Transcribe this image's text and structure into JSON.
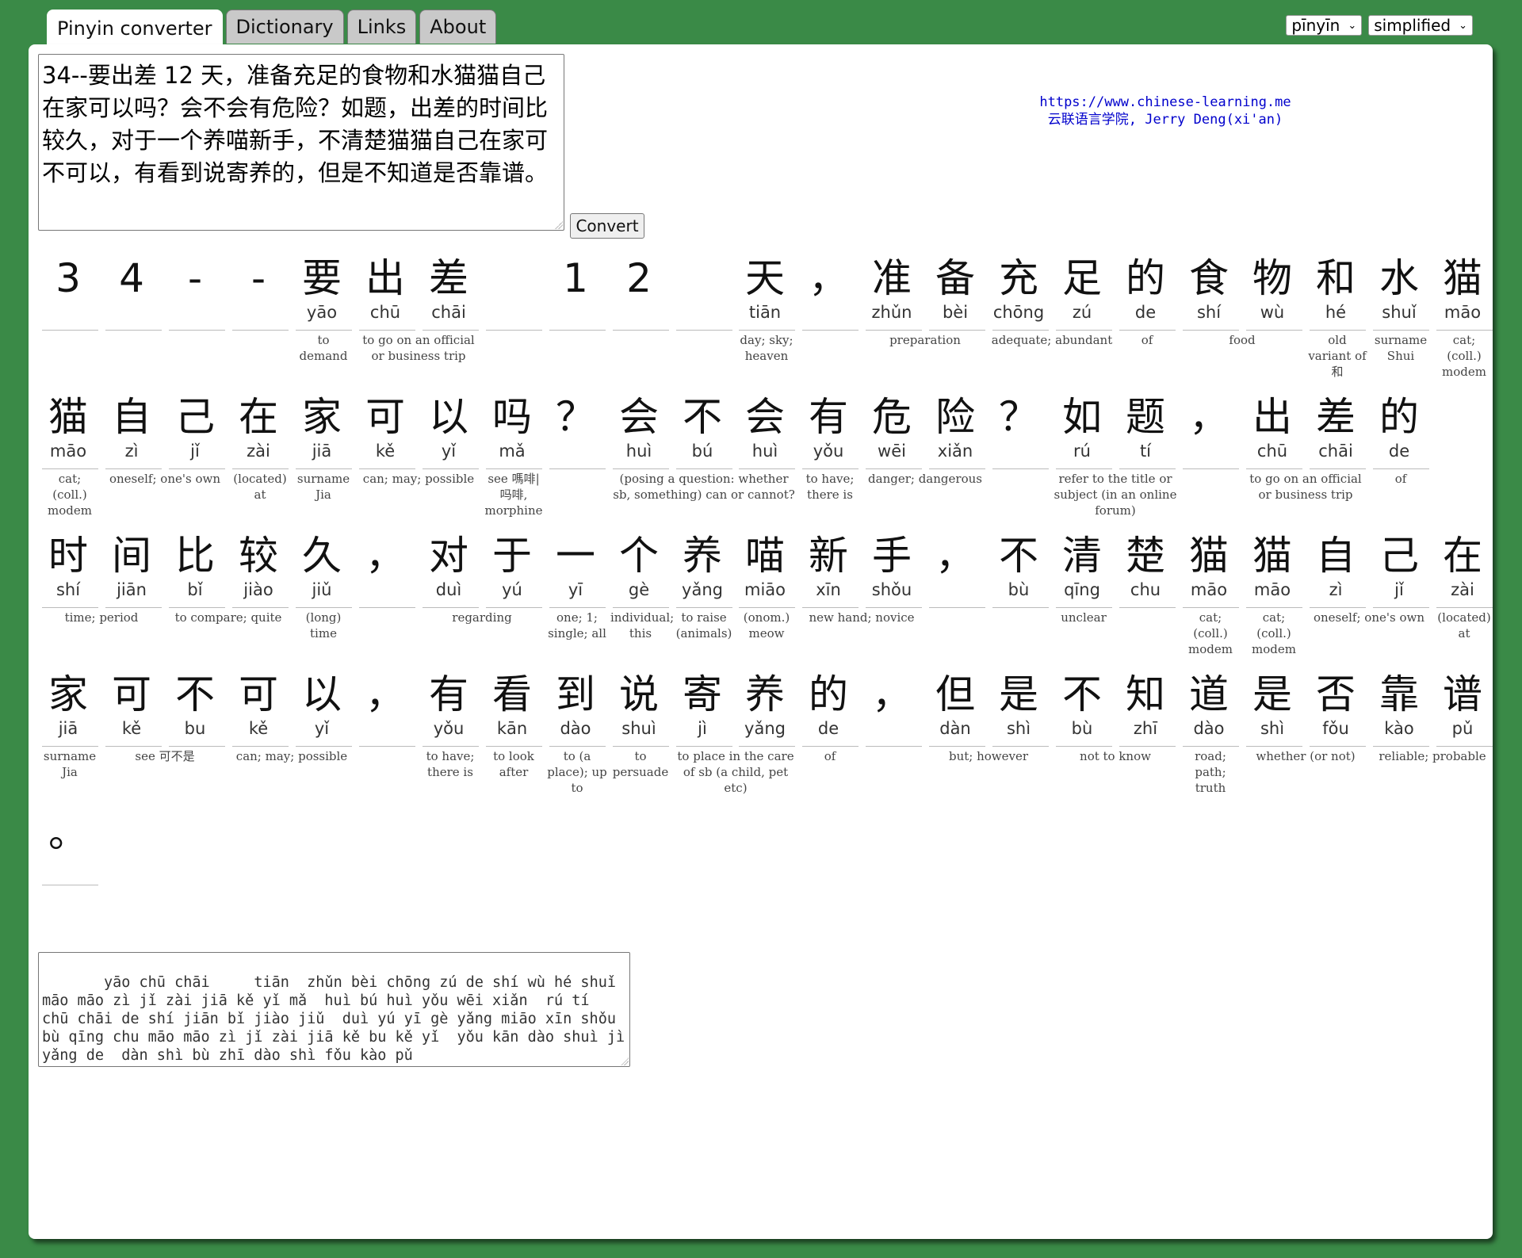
{
  "tabs": [
    "Pinyin converter",
    "Dictionary",
    "Links",
    "About"
  ],
  "selects": {
    "mode": "pīnyīn",
    "script": "simplified"
  },
  "input_text": "34--要出差 12 天，准备充足的食物和水猫猫自己在家可以吗？会不会有危险？如题，出差的时间比较久，对于一个养喵新手，不清楚猫猫自己在家可不可以，有看到说寄养的，但是不知道是否靠谱。",
  "convert_label": "Convert",
  "credit": {
    "url": "https://www.chinese-learning.me",
    "line2": "云联语言学院, Jerry Deng(xi'an)"
  },
  "rows": [
    {
      "chars": [
        "3",
        "4",
        "-",
        "-",
        "要",
        "出",
        "差",
        "",
        "1",
        "2",
        "",
        "天",
        "，",
        "准",
        "备",
        "充",
        "足",
        "的",
        "食",
        "物",
        "和",
        "水",
        "猫"
      ],
      "pinyin": [
        "",
        "",
        "",
        "",
        "yāo",
        "chū",
        "chāi",
        "",
        "",
        "",
        "",
        "tiān",
        "",
        "zhǔn",
        "bèi",
        "chōng",
        "zú",
        "de",
        "shí",
        "wù",
        "hé",
        "shuǐ",
        "māo"
      ],
      "defs": [
        {
          "start": 4,
          "span": 1,
          "text": "to demand"
        },
        {
          "start": 5,
          "span": 2,
          "text": "to go on an official or business trip"
        },
        {
          "start": 11,
          "span": 1,
          "text": "day; sky; heaven"
        },
        {
          "start": 13,
          "span": 2,
          "text": "preparation"
        },
        {
          "start": 15,
          "span": 2,
          "text": "adequate; abundant"
        },
        {
          "start": 17,
          "span": 1,
          "text": "of"
        },
        {
          "start": 18,
          "span": 2,
          "text": "food"
        },
        {
          "start": 20,
          "span": 1,
          "text": "old variant of 和"
        },
        {
          "start": 21,
          "span": 1,
          "text": "surname Shui"
        },
        {
          "start": 22,
          "span": 1,
          "text": "cat; (coll.) modem"
        }
      ]
    },
    {
      "chars": [
        "猫",
        "自",
        "己",
        "在",
        "家",
        "可",
        "以",
        "吗",
        "？",
        "会",
        "不",
        "会",
        "有",
        "危",
        "险",
        "？",
        "如",
        "题",
        "，",
        "出",
        "差",
        "的"
      ],
      "pinyin": [
        "māo",
        "zì",
        "jǐ",
        "zài",
        "jiā",
        "kě",
        "yǐ",
        "mǎ",
        "",
        "huì",
        "bú",
        "huì",
        "yǒu",
        "wēi",
        "xiǎn",
        "",
        "rú",
        "tí",
        "",
        "chū",
        "chāi",
        "de"
      ],
      "defs": [
        {
          "start": 0,
          "span": 1,
          "text": "cat; (coll.) modem"
        },
        {
          "start": 1,
          "span": 2,
          "text": "oneself; one's own"
        },
        {
          "start": 3,
          "span": 1,
          "text": "(located) at"
        },
        {
          "start": 4,
          "span": 1,
          "text": "surname Jia"
        },
        {
          "start": 5,
          "span": 2,
          "text": "can; may; possible"
        },
        {
          "start": 7,
          "span": 1,
          "text": "see 嗎啡| 吗啡, morphine"
        },
        {
          "start": 9,
          "span": 3,
          "text": "(posing a question: whether sb, something) can or cannot?"
        },
        {
          "start": 12,
          "span": 1,
          "text": "to have; there is"
        },
        {
          "start": 13,
          "span": 2,
          "text": "danger; dangerous"
        },
        {
          "start": 16,
          "span": 2,
          "text": "refer to the title or subject (in an online forum)"
        },
        {
          "start": 19,
          "span": 2,
          "text": "to go on an official or business trip"
        },
        {
          "start": 21,
          "span": 1,
          "text": "of"
        }
      ]
    },
    {
      "chars": [
        "时",
        "间",
        "比",
        "较",
        "久",
        "，",
        "对",
        "于",
        "一",
        "个",
        "养",
        "喵",
        "新",
        "手",
        "，",
        "不",
        "清",
        "楚",
        "猫",
        "猫",
        "自",
        "己",
        "在"
      ],
      "pinyin": [
        "shí",
        "jiān",
        "bǐ",
        "jiào",
        "jiǔ",
        "",
        "duì",
        "yú",
        "yī",
        "gè",
        "yǎng",
        "miāo",
        "xīn",
        "shǒu",
        "",
        "bù",
        "qīng",
        "chu",
        "māo",
        "māo",
        "zì",
        "jǐ",
        "zài"
      ],
      "defs": [
        {
          "start": 0,
          "span": 2,
          "text": "time; period"
        },
        {
          "start": 2,
          "span": 2,
          "text": "to compare; quite"
        },
        {
          "start": 4,
          "span": 1,
          "text": "(long) time"
        },
        {
          "start": 6,
          "span": 2,
          "text": "regarding"
        },
        {
          "start": 8,
          "span": 1,
          "text": "one; 1; single; all"
        },
        {
          "start": 9,
          "span": 1,
          "text": "individual; this"
        },
        {
          "start": 10,
          "span": 1,
          "text": "to raise (animals)"
        },
        {
          "start": 11,
          "span": 1,
          "text": "(onom.) meow"
        },
        {
          "start": 12,
          "span": 2,
          "text": "new hand; novice"
        },
        {
          "start": 15,
          "span": 3,
          "text": "unclear"
        },
        {
          "start": 18,
          "span": 1,
          "text": "cat; (coll.) modem"
        },
        {
          "start": 19,
          "span": 1,
          "text": "cat; (coll.) modem"
        },
        {
          "start": 20,
          "span": 2,
          "text": "oneself; one's own"
        },
        {
          "start": 22,
          "span": 1,
          "text": "(located) at"
        }
      ]
    },
    {
      "chars": [
        "家",
        "可",
        "不",
        "可",
        "以",
        "，",
        "有",
        "看",
        "到",
        "说",
        "寄",
        "养",
        "的",
        "，",
        "但",
        "是",
        "不",
        "知",
        "道",
        "是",
        "否",
        "靠",
        "谱"
      ],
      "pinyin": [
        "jiā",
        "kě",
        "bu",
        "kě",
        "yǐ",
        "",
        "yǒu",
        "kān",
        "dào",
        "shuì",
        "jì",
        "yǎng",
        "de",
        "",
        "dàn",
        "shì",
        "bù",
        "zhī",
        "dào",
        "shì",
        "fǒu",
        "kào",
        "pǔ"
      ],
      "defs": [
        {
          "start": 0,
          "span": 1,
          "text": "surname Jia"
        },
        {
          "start": 1,
          "span": 2,
          "text": "see 可不是"
        },
        {
          "start": 3,
          "span": 2,
          "text": "can; may; possible"
        },
        {
          "start": 6,
          "span": 1,
          "text": "to have; there is"
        },
        {
          "start": 7,
          "span": 1,
          "text": "to look after"
        },
        {
          "start": 8,
          "span": 1,
          "text": "to (a place); up to"
        },
        {
          "start": 9,
          "span": 1,
          "text": "to persuade"
        },
        {
          "start": 10,
          "span": 2,
          "text": "to place in the care of sb (a child, pet etc)"
        },
        {
          "start": 12,
          "span": 1,
          "text": "of"
        },
        {
          "start": 14,
          "span": 2,
          "text": "but; however"
        },
        {
          "start": 16,
          "span": 2,
          "text": "not to know"
        },
        {
          "start": 18,
          "span": 1,
          "text": "road; path; truth"
        },
        {
          "start": 19,
          "span": 2,
          "text": "whether (or not)"
        },
        {
          "start": 21,
          "span": 2,
          "text": "reliable; probable"
        }
      ]
    },
    {
      "chars": [
        "。"
      ],
      "pinyin": [
        ""
      ],
      "defs": []
    }
  ],
  "output_text": "   yāo chū chāi     tiān  zhǔn bèi chōng zú de shí wù hé shuǐ māo māo zì jǐ zài jiā kě yǐ mǎ  huì bú huì yǒu wēi xiǎn  rú tí  chū chāi de shí jiān bǐ jiào jiǔ  duì yú yī gè yǎng miāo xīn shǒu  bù qīng chu māo māo zì jǐ zài jiā kě bu kě yǐ  yǒu kān dào shuì jì yǎng de  dàn shì bù zhī dào shì fǒu kào pǔ"
}
